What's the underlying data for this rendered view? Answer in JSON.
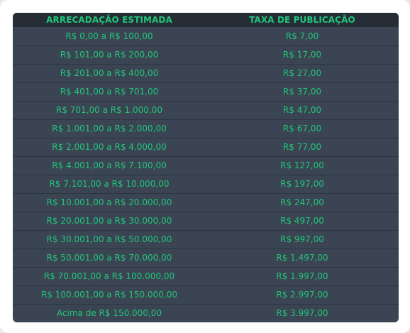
{
  "table": {
    "headers": [
      "ARRECADAÇÃO ESTIMADA",
      "TAXA DE PUBLICAÇÃO"
    ],
    "rows": [
      [
        "R$ 0,00 a R$ 100,00",
        "R$ 7,00"
      ],
      [
        "R$ 101,00 a R$ 200,00",
        "R$ 17,00"
      ],
      [
        "R$ 201,00 a R$ 400,00",
        "R$ 27,00"
      ],
      [
        "R$ 401,00 a R$ 701,00",
        "R$ 37,00"
      ],
      [
        "R$ 701,00 a R$ 1.000,00",
        "R$ 47,00"
      ],
      [
        "R$ 1.001,00 a R$ 2.000,00",
        "R$ 67,00"
      ],
      [
        "R$ 2.001,00 a R$ 4.000,00",
        "R$ 77,00"
      ],
      [
        "R$ 4.001,00 a R$ 7.100,00",
        "R$ 127,00"
      ],
      [
        "R$ 7.101,00 a R$ 10.000,00",
        "R$ 197,00"
      ],
      [
        "R$ 10.001,00 a R$ 20.000,00",
        "R$ 247,00"
      ],
      [
        "R$ 20.001,00 a R$ 30.000,00",
        "R$ 497,00"
      ],
      [
        "R$ 30.001,00 a R$ 50.000,00",
        "R$ 997,00"
      ],
      [
        "R$ 50.001,00 a R$ 70.000,00",
        "R$ 1.497,00"
      ],
      [
        "R$ 70.001,00 a R$ 100.000,00",
        "R$ 1.997,00"
      ],
      [
        "R$ 100.001,00 a R$ 150.000,00",
        "R$ 2.997,00"
      ],
      [
        "Acima de R$ 150.000,00",
        "R$ 3.997,00"
      ]
    ]
  },
  "colors": {
    "accent_text": "#22c57a",
    "table_bg": "#3a4452",
    "header_bg": "#262d37"
  }
}
